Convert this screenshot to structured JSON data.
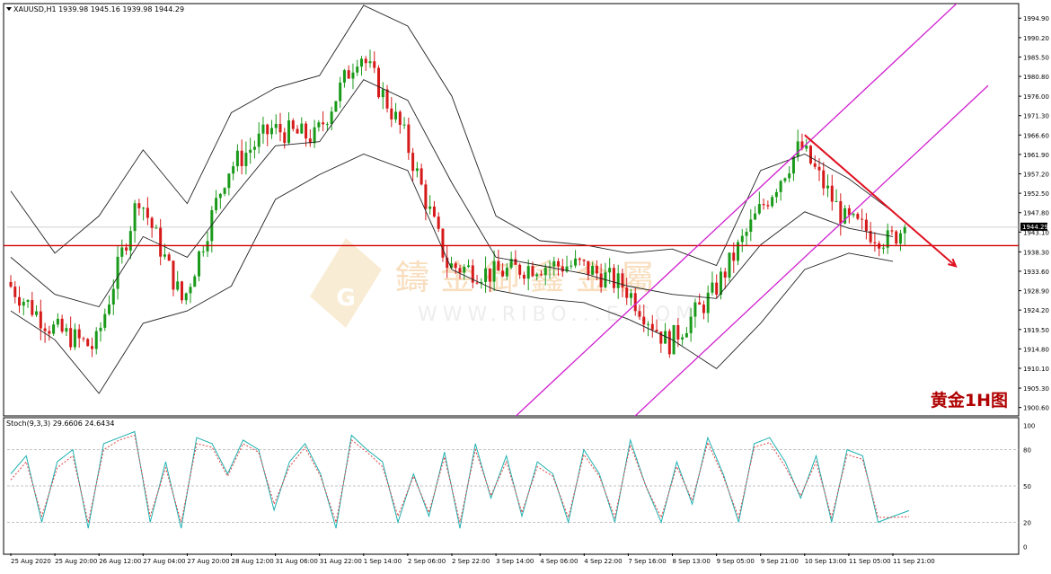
{
  "header": {
    "main_info": "XAUUSD,H1  1939.98 1945.16 1939.98 1944.29",
    "stoch_info": "Stoch(9,3,3) 29.6606 24.6434"
  },
  "annotation": "黄金1H图",
  "watermark": {
    "cn_text": "鑄 金 御 鑫 金 屬",
    "url": "WWW.RIBO...E.COM"
  },
  "colors": {
    "background": "#ffffff",
    "up_candle": "#1a9a1a",
    "down_candle": "#d61a1a",
    "bollinger": "#222222",
    "channel": "#d020d0",
    "support_line": "#d00000",
    "arrow": "#e01020",
    "stoch_main": "#20b0b0",
    "stoch_signal": "#e04040",
    "annotation": "#b00000",
    "watermark": "#f0c890"
  },
  "chart_data": [
    {
      "type": "candlestick",
      "title": "XAUUSD,H1",
      "symbol": "XAUUSD",
      "timeframe": "H1",
      "last_ohlc": {
        "open": 1939.98,
        "high": 1945.16,
        "low": 1939.98,
        "close": 1944.29
      },
      "ylim": [
        1899.0,
        1998.0
      ],
      "y_ticks": [
        "1994.90",
        "1990.20",
        "1985.50",
        "1980.80",
        "1976.00",
        "1971.30",
        "1966.60",
        "1961.90",
        "1957.20",
        "1952.50",
        "1947.80",
        "1943.10",
        "1938.30",
        "1933.60",
        "1928.90",
        "1924.20",
        "1919.50",
        "1914.80",
        "1910.10",
        "1905.30",
        "1900.60"
      ],
      "x_ticks": [
        "25 Aug 2020",
        "25 Aug 20:00",
        "26 Aug 12:00",
        "27 Aug 04:00",
        "27 Aug 20:00",
        "28 Aug 12:00",
        "31 Aug 06:00",
        "31 Aug 22:00",
        "1 Sep 14:00",
        "2 Sep 06:00",
        "2 Sep 22:00",
        "3 Sep 14:00",
        "4 Sep 06:00",
        "4 Sep 22:00",
        "7 Sep 16:00",
        "8 Sep 13:00",
        "9 Sep 05:00",
        "9 Sep 21:00",
        "10 Sep 13:00",
        "11 Sep 05:00",
        "11 Sep 21:00"
      ],
      "price_label": "1944.29",
      "horizontal_line": 1939.8,
      "close_path": [
        {
          "x": "25 Aug 2020",
          "y": 1931
        },
        {
          "x": "25 Aug 20:00",
          "y": 1920
        },
        {
          "x": "26 Aug 12:00",
          "y": 1915
        },
        {
          "x": "27 Aug 04:00",
          "y": 1952
        },
        {
          "x": "27 Aug 20:00",
          "y": 1926
        },
        {
          "x": "28 Aug 12:00",
          "y": 1958
        },
        {
          "x": "31 Aug 06:00",
          "y": 1968
        },
        {
          "x": "31 Aug 22:00",
          "y": 1966
        },
        {
          "x": "1 Sep 14:00",
          "y": 1987
        },
        {
          "x": "2 Sep 06:00",
          "y": 1967
        },
        {
          "x": "2 Sep 22:00",
          "y": 1935
        },
        {
          "x": "3 Sep 14:00",
          "y": 1933
        },
        {
          "x": "4 Sep 06:00",
          "y": 1935
        },
        {
          "x": "4 Sep 22:00",
          "y": 1935
        },
        {
          "x": "7 Sep 16:00",
          "y": 1930
        },
        {
          "x": "8 Sep 13:00",
          "y": 1916
        },
        {
          "x": "9 Sep 05:00",
          "y": 1928
        },
        {
          "x": "9 Sep 21:00",
          "y": 1947
        },
        {
          "x": "10 Sep 13:00",
          "y": 1964
        },
        {
          "x": "11 Sep 05:00",
          "y": 1946
        },
        {
          "x": "11 Sep 21:00",
          "y": 1941
        },
        {
          "x": "11 Sep 21:00",
          "y": 1944.29
        }
      ],
      "bollinger_upper": [
        {
          "x": "25 Aug 2020",
          "y": 1953
        },
        {
          "x": "25 Aug 20:00",
          "y": 1938
        },
        {
          "x": "26 Aug 12:00",
          "y": 1947
        },
        {
          "x": "27 Aug 04:00",
          "y": 1963
        },
        {
          "x": "27 Aug 20:00",
          "y": 1950
        },
        {
          "x": "28 Aug 12:00",
          "y": 1972
        },
        {
          "x": "31 Aug 06:00",
          "y": 1978
        },
        {
          "x": "31 Aug 22:00",
          "y": 1981
        },
        {
          "x": "1 Sep 14:00",
          "y": 1998
        },
        {
          "x": "2 Sep 06:00",
          "y": 1993
        },
        {
          "x": "2 Sep 22:00",
          "y": 1976
        },
        {
          "x": "3 Sep 14:00",
          "y": 1947
        },
        {
          "x": "4 Sep 06:00",
          "y": 1941
        },
        {
          "x": "4 Sep 22:00",
          "y": 1940
        },
        {
          "x": "7 Sep 16:00",
          "y": 1938
        },
        {
          "x": "8 Sep 13:00",
          "y": 1939
        },
        {
          "x": "9 Sep 05:00",
          "y": 1935
        },
        {
          "x": "9 Sep 21:00",
          "y": 1958
        },
        {
          "x": "10 Sep 13:00",
          "y": 1962
        },
        {
          "x": "11 Sep 05:00",
          "y": 1956
        },
        {
          "x": "11 Sep 21:00",
          "y": 1948
        }
      ],
      "bollinger_middle": [
        {
          "x": "25 Aug 2020",
          "y": 1937
        },
        {
          "x": "25 Aug 20:00",
          "y": 1928
        },
        {
          "x": "26 Aug 12:00",
          "y": 1925
        },
        {
          "x": "27 Aug 04:00",
          "y": 1942
        },
        {
          "x": "27 Aug 20:00",
          "y": 1937
        },
        {
          "x": "28 Aug 12:00",
          "y": 1951
        },
        {
          "x": "31 Aug 06:00",
          "y": 1964
        },
        {
          "x": "31 Aug 22:00",
          "y": 1965
        },
        {
          "x": "1 Sep 14:00",
          "y": 1980
        },
        {
          "x": "2 Sep 06:00",
          "y": 1975
        },
        {
          "x": "2 Sep 22:00",
          "y": 1955
        },
        {
          "x": "3 Sep 14:00",
          "y": 1937
        },
        {
          "x": "4 Sep 06:00",
          "y": 1935
        },
        {
          "x": "4 Sep 22:00",
          "y": 1933
        },
        {
          "x": "7 Sep 16:00",
          "y": 1930
        },
        {
          "x": "8 Sep 13:00",
          "y": 1928
        },
        {
          "x": "9 Sep 05:00",
          "y": 1927
        },
        {
          "x": "9 Sep 21:00",
          "y": 1940
        },
        {
          "x": "10 Sep 13:00",
          "y": 1948
        },
        {
          "x": "11 Sep 05:00",
          "y": 1944
        },
        {
          "x": "11 Sep 21:00",
          "y": 1942
        }
      ],
      "bollinger_lower": [
        {
          "x": "25 Aug 2020",
          "y": 1924
        },
        {
          "x": "25 Aug 20:00",
          "y": 1917
        },
        {
          "x": "26 Aug 12:00",
          "y": 1904
        },
        {
          "x": "27 Aug 04:00",
          "y": 1921
        },
        {
          "x": "27 Aug 20:00",
          "y": 1924
        },
        {
          "x": "28 Aug 12:00",
          "y": 1930
        },
        {
          "x": "31 Aug 06:00",
          "y": 1951
        },
        {
          "x": "31 Aug 22:00",
          "y": 1957
        },
        {
          "x": "1 Sep 14:00",
          "y": 1962
        },
        {
          "x": "2 Sep 06:00",
          "y": 1958
        },
        {
          "x": "2 Sep 22:00",
          "y": 1934
        },
        {
          "x": "3 Sep 14:00",
          "y": 1929
        },
        {
          "x": "4 Sep 06:00",
          "y": 1927
        },
        {
          "x": "4 Sep 22:00",
          "y": 1926
        },
        {
          "x": "7 Sep 16:00",
          "y": 1922
        },
        {
          "x": "8 Sep 13:00",
          "y": 1917
        },
        {
          "x": "9 Sep 05:00",
          "y": 1910
        },
        {
          "x": "9 Sep 21:00",
          "y": 1921
        },
        {
          "x": "10 Sep 13:00",
          "y": 1934
        },
        {
          "x": "11 Sep 05:00",
          "y": 1938
        },
        {
          "x": "11 Sep 21:00",
          "y": 1936
        }
      ],
      "channel_lower": [
        {
          "x": "8 Sep 13:00",
          "y": 1907
        },
        {
          "x": "11 Sep 21:00",
          "y": 1957
        }
      ],
      "channel_upper": [
        {
          "x": "8 Sep 13:00",
          "y": 1934
        },
        {
          "x": "10 Sep 13:00",
          "y": 1964
        }
      ],
      "downtrend_arrow": [
        {
          "x": "10 Sep 13:00",
          "y": 1966.6
        },
        {
          "x": "11 Sep 21:00",
          "y": 1937
        }
      ]
    },
    {
      "type": "line",
      "title": "Stoch(9,3,3)",
      "ylim": [
        -5,
        105
      ],
      "y_ticks": [
        "100",
        "80",
        "50",
        "20",
        "0"
      ],
      "levels": [
        80,
        50,
        20
      ],
      "series": [
        {
          "name": "main",
          "values": [
            60,
            75,
            20,
            70,
            80,
            15,
            85,
            90,
            95,
            20,
            70,
            15,
            90,
            85,
            60,
            88,
            80,
            30,
            70,
            85,
            60,
            15,
            92,
            80,
            70,
            20,
            60,
            25,
            78,
            15,
            85,
            40,
            75,
            25,
            70,
            60,
            20,
            80,
            60,
            20,
            88,
            50,
            20,
            70,
            35,
            90,
            60,
            20,
            85,
            90,
            70,
            40,
            75,
            20,
            80,
            75,
            20,
            25,
            29.66
          ]
        },
        {
          "name": "signal",
          "values": [
            55,
            70,
            25,
            65,
            75,
            20,
            80,
            88,
            92,
            25,
            65,
            20,
            85,
            82,
            58,
            85,
            78,
            35,
            66,
            82,
            58,
            20,
            88,
            78,
            66,
            25,
            58,
            28,
            74,
            20,
            80,
            42,
            70,
            28,
            66,
            58,
            24,
            76,
            58,
            24,
            84,
            50,
            24,
            66,
            38,
            86,
            58,
            24,
            82,
            86,
            66,
            42,
            70,
            24,
            76,
            72,
            24,
            24,
            24.64
          ]
        }
      ]
    }
  ]
}
